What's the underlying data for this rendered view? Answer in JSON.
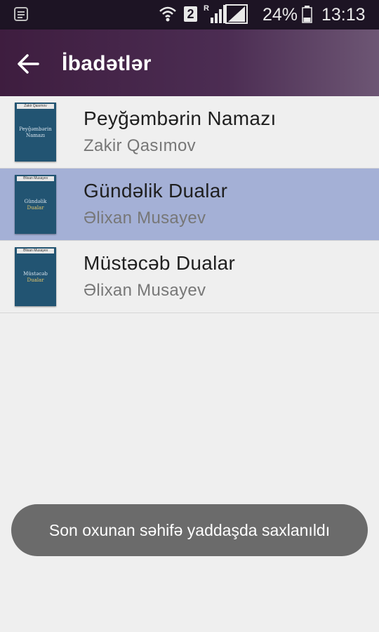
{
  "status_bar": {
    "sim_slot": "2",
    "roaming_indicator": "R",
    "battery_percent": "24%",
    "time": "13:13",
    "icons": [
      "notification-icon",
      "wifi-icon",
      "signal-icon",
      "battery-icon"
    ]
  },
  "app_bar": {
    "title": "İbadətlər",
    "back_icon": "arrow-left-icon"
  },
  "books": [
    {
      "title": "Peyğəmbərin Namazı",
      "author": "Zakir Qasımov",
      "selected": false,
      "cover": {
        "strip": "Zakir Qasımov",
        "line1": "Peyğəmbərin",
        "line2": "Namazı",
        "color": "#225472"
      }
    },
    {
      "title": "Gündəlik Dualar",
      "author": "Əlixan Musayev",
      "selected": true,
      "cover": {
        "strip": "Əlixan Musayev",
        "line1": "Gündəlik",
        "line2": "Dualar",
        "color": "#225472"
      }
    },
    {
      "title": "Müstəcəb Dualar",
      "author": "Əlixan Musayev",
      "selected": false,
      "cover": {
        "strip": "Əlixan Musayev",
        "line1": "Müstəcəb",
        "line2": "Dualar",
        "color": "#225472"
      }
    }
  ],
  "toast": {
    "message": "Son oxunan səhifə yaddaşda saxlanıldı"
  },
  "colors": {
    "status_bar": "#1d1424",
    "app_bar": "#4c2d53",
    "selected_row": "#a4b0d6",
    "background": "#efefef",
    "toast": "#6b6b6b"
  }
}
